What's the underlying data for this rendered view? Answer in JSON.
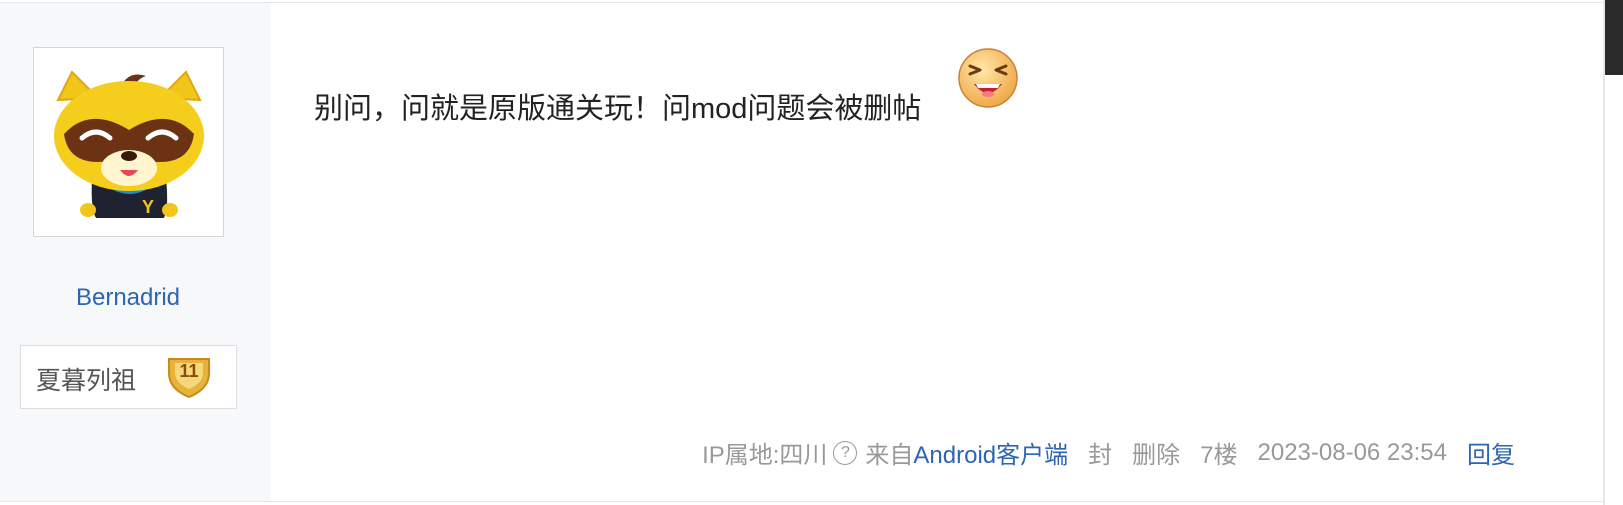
{
  "author": {
    "username": "Bernadrid",
    "badge_title": "夏暮列祖",
    "badge_level": "11"
  },
  "post": {
    "content": "别问，问就是原版通关玩！问mod问题会被删帖",
    "inline_emoji": "laughing-face-emoji"
  },
  "footer": {
    "ip_location": "IP属地:四川",
    "help_symbol": "?",
    "source_prefix": "来自",
    "source_link": "Android客户端",
    "ban": "封",
    "delete": "删除",
    "floor": "7楼",
    "timestamp": "2023-08-06 23:54",
    "reply": "回复"
  },
  "colors": {
    "link_blue": "#2d64b3",
    "muted_gray": "#999999",
    "sidebar_bg": "#f7f8fa",
    "badge_gold": "#e8b33c"
  }
}
